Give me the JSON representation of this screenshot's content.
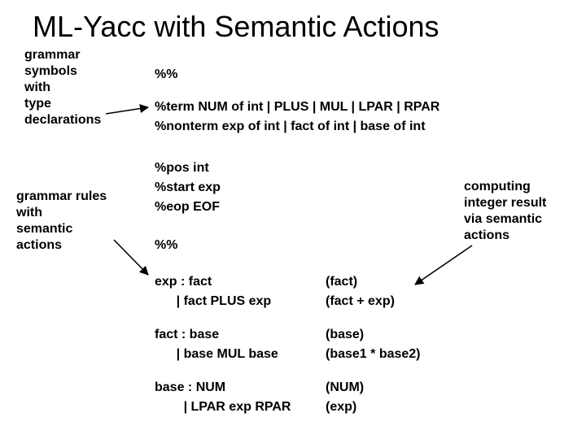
{
  "title": "ML-Yacc with Semantic Actions",
  "annotations": {
    "grammar_symbols": "grammar\nsymbols\nwith\ntype\ndeclarations",
    "grammar_rules": "grammar rules\nwith\nsemantic\nactions",
    "computing": "computing\ninteger result\nvia semantic\nactions"
  },
  "code": {
    "sep1": "%%",
    "term": "%term NUM of int | PLUS | MUL | LPAR | RPAR",
    "nonterm": "%nonterm exp of int | fact of int | base of int",
    "pos": "%pos int",
    "start": "%start exp",
    "eop": "%eop EOF",
    "sep2": "%%",
    "r1a": "exp : fact",
    "r1b": "      | fact PLUS exp",
    "r2a": "fact : base",
    "r2b": "      | base MUL base",
    "r3a": "base : NUM",
    "r3b": "        | LPAR exp RPAR",
    "a1a": "(fact)",
    "a1b": "(fact + exp)",
    "a2a": "(base)",
    "a2b": "(base1 * base2)",
    "a3a": "(NUM)",
    "a3b": "(exp)"
  }
}
